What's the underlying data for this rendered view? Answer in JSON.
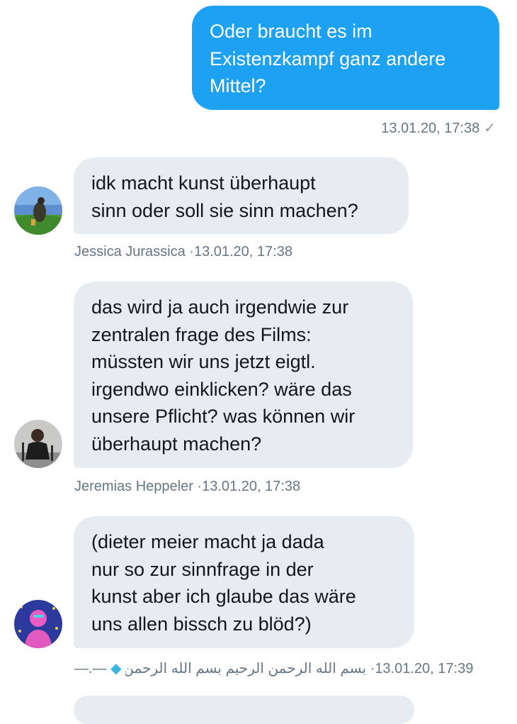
{
  "messages": [
    {
      "direction": "out",
      "text": "Oder braucht es im\nExistenzkampf ganz andere\nMittel?",
      "timestamp": "13.01.20, 17:38",
      "status_icon": "check-icon"
    },
    {
      "direction": "in",
      "sender": "Jessica Jurassica",
      "text": "idk macht kunst überhaupt\nsinn oder soll sie sinn machen?",
      "timestamp": "13.01.20, 17:38",
      "avatar": "avatar-jessica"
    },
    {
      "direction": "in",
      "sender": "Jeremias Heppeler",
      "text": "das wird ja auch irgendwie zur\nzentralen frage des Films:\nmüssten wir uns jetzt eigtl.\nirgendwo einklicken? wäre das\nunsere Pflicht? was können wir\nüberhaupt machen?",
      "timestamp": "13.01.20, 17:38",
      "avatar": "avatar-jeremias"
    },
    {
      "direction": "in",
      "sender": "بسم الله الرحمن الرحيم بسم الله الرحمن الرحيم بسم الله الرحمن الرحيم بسم الله الرحمن الرحيم...",
      "sender_prefix": "—.—",
      "text": "(dieter meier macht ja dada\nnur so zur sinnfrage in der\nkunst aber ich glaube das wäre\nuns allen bissch zu blöd?)",
      "timestamp": "13.01.20, 17:39",
      "avatar": "avatar-third"
    }
  ],
  "separator": "·",
  "colors": {
    "outgoing_bubble": "#1da1f2",
    "incoming_bubble": "#e6ecf0",
    "meta_text": "#657786"
  }
}
